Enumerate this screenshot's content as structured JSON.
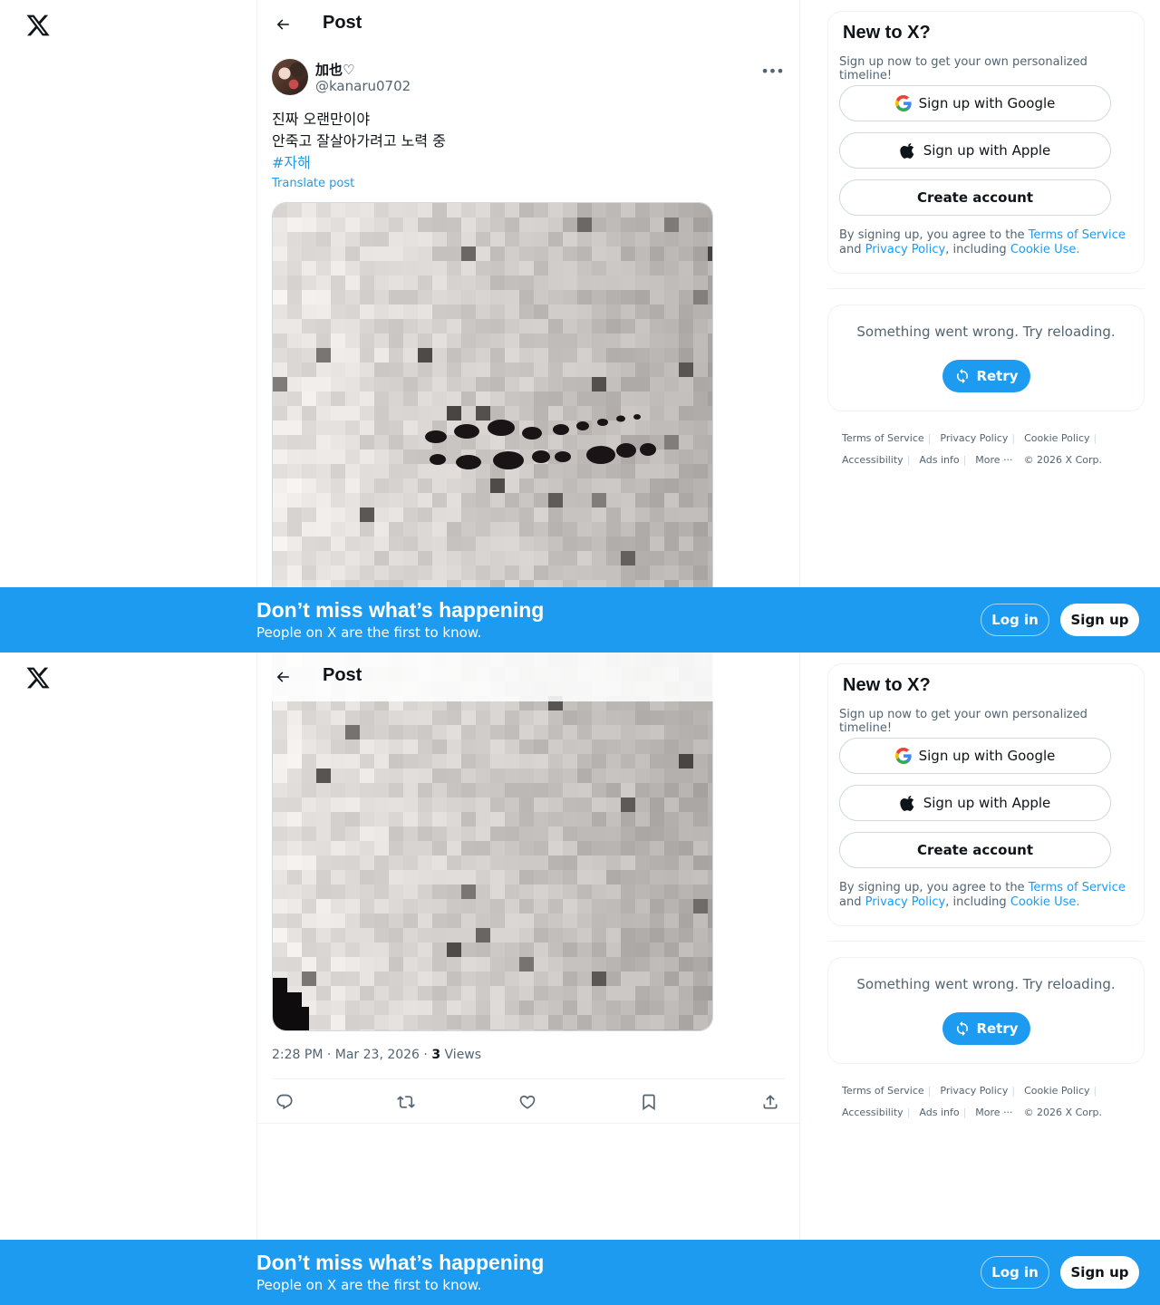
{
  "topbar": {
    "title": "Post"
  },
  "author": {
    "name": "加也♡",
    "handle": "@kanaru0702"
  },
  "post": {
    "lines": [
      "진짜 오랜만이야",
      "안죽고 잘살아가려고 노력 중"
    ],
    "hashtag": "#자해",
    "translate": "Translate post",
    "time": "2:28 PM · Mar 23, 2026 · ",
    "views_count": "3",
    "views_label": " Views"
  },
  "sidebar": {
    "title": "New to X?",
    "subtitle": "Sign up now to get your own personalized timeline!",
    "google_label": "Sign up with Google",
    "apple_label": "Sign up with Apple",
    "create_label": "Create account",
    "terms_prefix": "By signing up, you agree to the ",
    "terms_link": "Terms of Service",
    "terms_and": " and ",
    "privacy_link": "Privacy Policy",
    "terms_including": ", including ",
    "cookie_link": "Cookie Use.",
    "error_text": "Something went wrong. Try reloading.",
    "retry_label": "Retry"
  },
  "footer": {
    "links": [
      "Terms of Service",
      "Privacy Policy",
      "Cookie Policy",
      "Accessibility",
      "Ads info",
      "More ···"
    ],
    "copyright": "© 2026 X Corp."
  },
  "banner": {
    "title": "Don’t miss what’s happening",
    "subtitle": "People on X are the first to know.",
    "login_label": "Log in",
    "signup_label": "Sign up"
  },
  "colors": {
    "accent": "#1d9bf0",
    "text": "#0f1419",
    "muted": "#536471"
  }
}
